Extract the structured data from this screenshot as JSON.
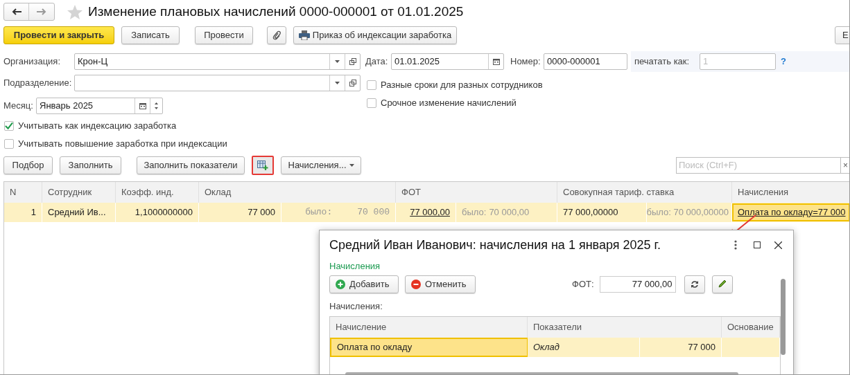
{
  "window": {
    "title": "Изменение плановых начислений 0000-000001 от 01.01.2025",
    "favorite": false
  },
  "toolbar": [
    {
      "kind": "primary",
      "label": "Провести и закрыть"
    },
    {
      "kind": "plain",
      "label": "Записать"
    },
    {
      "kind": "plain",
      "label": "Провести"
    },
    {
      "kind": "attach"
    },
    {
      "kind": "print",
      "label": "Приказ об индексации заработка"
    }
  ],
  "cut_button": "Е",
  "fields": {
    "organization": {
      "label": "Организация:",
      "value": "Крон-Ц"
    },
    "department": {
      "label": "Подразделение:"
    },
    "month": {
      "label": "Месяц:",
      "value": "Январь 2025"
    },
    "date": {
      "label": "Дата:",
      "value": "01.01.2025"
    },
    "number": {
      "label": "Номер:",
      "value": "0000-000001"
    },
    "print_as": {
      "label": "печатать как:",
      "placeholder": "1",
      "help": "?"
    }
  },
  "right_checks": [
    {
      "label": "Разные сроки для разных сотрудников",
      "checked": false
    },
    {
      "label": "Срочное изменение начислений",
      "checked": false
    }
  ],
  "left_checks": [
    {
      "label": "Учитывать как индексацию заработка",
      "checked": true
    },
    {
      "label": "Учитывать повышение заработка при индексации",
      "checked": false
    }
  ],
  "table_buttons": [
    {
      "kind": "plain",
      "label": "Подбор"
    },
    {
      "kind": "plain",
      "label": "Заполнить"
    },
    {
      "kind": "plain",
      "label": "Заполнить показатели"
    },
    {
      "kind": "icon",
      "highlighted": true
    },
    {
      "kind": "menu",
      "label": "Начисления..."
    }
  ],
  "search": {
    "placeholder": "Поиск (Ctrl+F)",
    "clear": "×"
  },
  "table": {
    "columns": [
      "N",
      "Сотрудник",
      "Коэфф. инд.",
      "Оклад",
      "ФОТ",
      "Совокупная тариф. ставка",
      "Начисления"
    ],
    "rows": [
      {
        "selected": true,
        "n": "1",
        "employee": "Средний Ив...",
        "coef": "1,1000000000",
        "salary": "77 000",
        "salary_was_label": "было:",
        "salary_was": "70 000",
        "fot": "77 000,00",
        "fot_was_label": "было:",
        "fot_was": "70 000,00",
        "rate": "77 000,00000",
        "rate_was": "было: 70 000,00000",
        "accruals": "Оплата по окладу=77 000"
      }
    ]
  },
  "dialog": {
    "title": "Средний Иван Иванович: начисления на 1 января 2025 г.",
    "group": "Начисления",
    "buttons": [
      {
        "kind": "add",
        "label": "Добавить"
      },
      {
        "kind": "cancel",
        "label": "Отменить"
      }
    ],
    "fot": {
      "label": "ФОТ:",
      "value": "77 000,00"
    },
    "table_label": "Начисления:",
    "columns": [
      "Начисление",
      "Показатели",
      "Основание"
    ],
    "rows": [
      {
        "selected": true,
        "accrual": "Оплата по окладу",
        "indicator": "Оклад",
        "amount": "77 000"
      }
    ]
  }
}
